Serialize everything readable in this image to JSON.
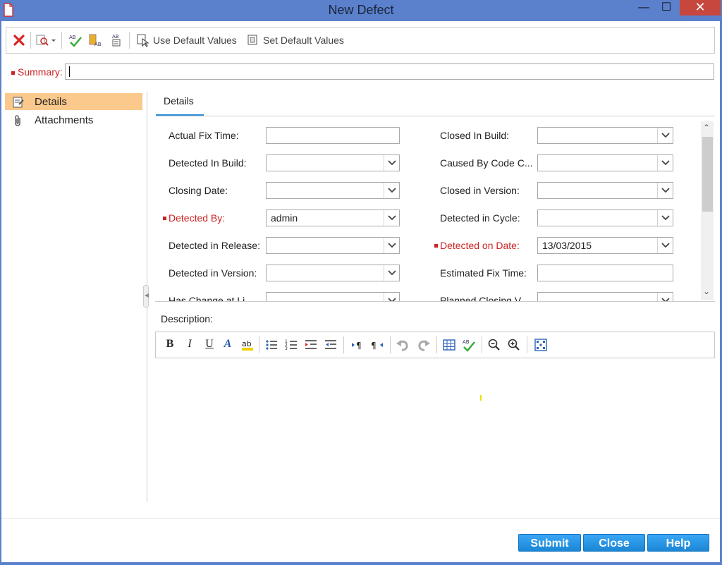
{
  "window": {
    "title": "New Defect",
    "min_glyph": "—",
    "max_glyph": "☐",
    "close_glyph": "✕"
  },
  "toolbar": {
    "use_default_values": "Use Default Values",
    "set_default_values": "Set Default Values"
  },
  "summary": {
    "label": "Summary:",
    "value": ""
  },
  "sidebar": {
    "items": [
      {
        "label": "Details",
        "icon": "details-icon",
        "selected": true
      },
      {
        "label": "Attachments",
        "icon": "paperclip-icon",
        "selected": false
      }
    ]
  },
  "tabs": [
    {
      "label": "Details",
      "active": true
    }
  ],
  "fields": {
    "left": [
      {
        "label": "Actual Fix Time:",
        "value": "",
        "type": "text",
        "required": false
      },
      {
        "label": "Detected In Build:",
        "value": "",
        "type": "select",
        "required": false
      },
      {
        "label": "Closing Date:",
        "value": "",
        "type": "select",
        "required": false
      },
      {
        "label": "Detected By:",
        "value": "admin",
        "type": "select",
        "required": true
      },
      {
        "label": "Detected in Release:",
        "value": "",
        "type": "select",
        "required": false
      },
      {
        "label": "Detected in Version:",
        "value": "",
        "type": "select",
        "required": false
      },
      {
        "label": "Has Change at Li...",
        "value": "",
        "type": "select",
        "required": false
      }
    ],
    "right": [
      {
        "label": "Closed In Build:",
        "value": "",
        "type": "select",
        "required": false
      },
      {
        "label": "Caused By Code C...",
        "value": "",
        "type": "select",
        "required": false
      },
      {
        "label": "Closed in Version:",
        "value": "",
        "type": "select",
        "required": false
      },
      {
        "label": "Detected in Cycle:",
        "value": "",
        "type": "select",
        "required": false
      },
      {
        "label": "Detected on Date:",
        "value": "13/03/2015",
        "type": "select",
        "required": true
      },
      {
        "label": "Estimated Fix Time:",
        "value": "",
        "type": "text",
        "required": false
      },
      {
        "label": "Planned Closing V...",
        "value": "",
        "type": "select",
        "required": false
      }
    ]
  },
  "description": {
    "label": "Description:",
    "value": ""
  },
  "buttons": {
    "submit": "Submit",
    "close": "Close",
    "help": "Help"
  },
  "colors": {
    "titlebar": "#5b80cc",
    "accent": "#1a86d6",
    "required": "#cc2222",
    "selected": "#fbc98c",
    "close_btn": "#c7463d"
  }
}
